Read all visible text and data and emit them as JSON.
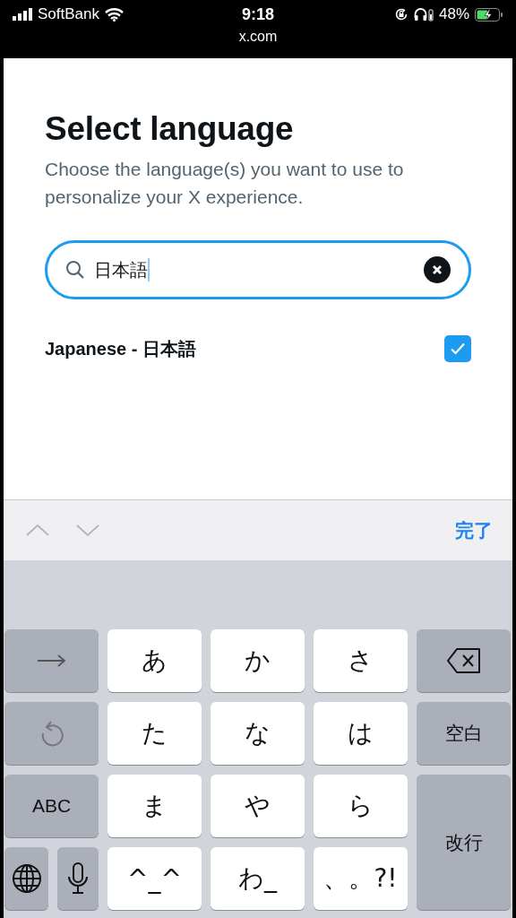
{
  "status_bar": {
    "carrier": "SoftBank",
    "time": "9:18",
    "battery_percent": "48%",
    "url": "x.com"
  },
  "page": {
    "title": "Select language",
    "description": "Choose the language(s) you want to use to personalize your X experience.",
    "search": {
      "value": "日本語"
    },
    "languages": [
      {
        "label": "Japanese - 日本語",
        "checked": true
      }
    ]
  },
  "accessory_bar": {
    "nav": [
      {
        "kind": "up",
        "disabled": true
      },
      {
        "kind": "down",
        "disabled": true
      }
    ],
    "done": "完了"
  },
  "keyboard": {
    "keys": [
      {
        "kind": "next"
      },
      {
        "kind": "char",
        "label": "あ"
      },
      {
        "kind": "char",
        "label": "か"
      },
      {
        "kind": "char",
        "label": "さ"
      },
      {
        "kind": "delete"
      },
      {
        "kind": "undo"
      },
      {
        "kind": "char",
        "label": "た"
      },
      {
        "kind": "char",
        "label": "な"
      },
      {
        "kind": "char",
        "label": "は"
      },
      {
        "kind": "space",
        "label": "空白"
      },
      {
        "kind": "function",
        "label": "ABC"
      },
      {
        "kind": "char",
        "label": "ま"
      },
      {
        "kind": "char",
        "label": "や"
      },
      {
        "kind": "char",
        "label": "ら"
      },
      {
        "kind": "return",
        "label": "改行"
      },
      {
        "kind": "globe"
      },
      {
        "kind": "mic"
      },
      {
        "kind": "char",
        "label": "^_^"
      },
      {
        "kind": "char",
        "label": "わ_"
      },
      {
        "kind": "char",
        "label": "、。?!"
      }
    ]
  }
}
